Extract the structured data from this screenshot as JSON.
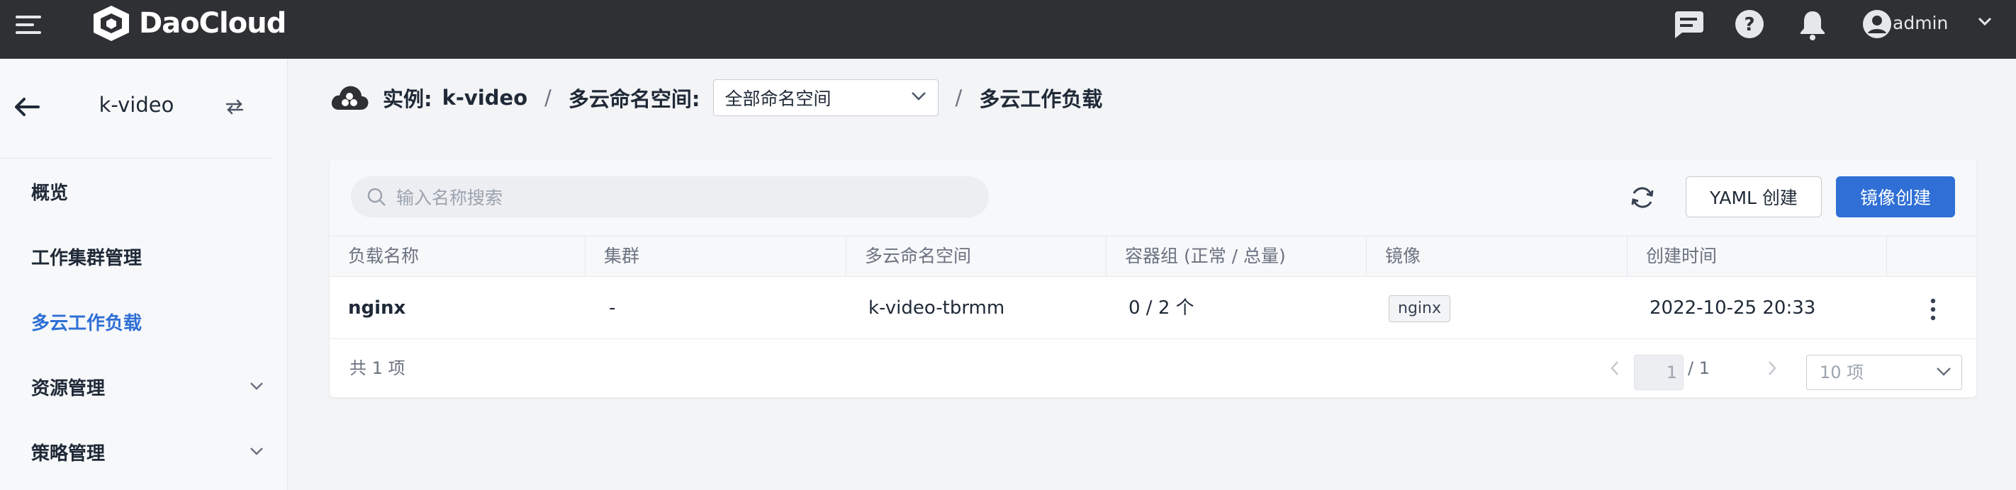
{
  "header": {
    "brand": "DaoCloud",
    "user": "admin",
    "icons": [
      "menu-icon",
      "logo-icon",
      "message-icon",
      "help-icon",
      "bell-icon",
      "user-icon",
      "chevron-down-icon"
    ]
  },
  "sidebar": {
    "title": "k-video",
    "items": [
      {
        "label": "概览",
        "active": false,
        "expandable": false
      },
      {
        "label": "工作集群管理",
        "active": false,
        "expandable": false
      },
      {
        "label": "多云工作负载",
        "active": true,
        "expandable": false
      },
      {
        "label": "资源管理",
        "active": false,
        "expandable": true
      },
      {
        "label": "策略管理",
        "active": false,
        "expandable": true
      }
    ]
  },
  "breadcrumb": {
    "instance_label": "实例:",
    "instance_value": "k-video",
    "namespace_label": "多云命名空间:",
    "namespace_select": "全部命名空间",
    "separator": "/",
    "current": "多云工作负载"
  },
  "toolbar": {
    "search_placeholder": "输入名称搜索",
    "yaml_button": "YAML 创建",
    "image_button": "镜像创建"
  },
  "table": {
    "columns": [
      "负载名称",
      "集群",
      "多云命名空间",
      "容器组 (正常 / 总量)",
      "镜像",
      "创建时间"
    ],
    "rows": [
      {
        "name": "nginx",
        "cluster": "-",
        "namespace": "k-video-tbrmm",
        "pods": "0 / 2 个",
        "image": "nginx",
        "created": "2022-10-25 20:33"
      }
    ]
  },
  "pagination": {
    "total": "共 1 项",
    "current_page": "1",
    "total_pages": "/ 1",
    "page_size": "10 项"
  },
  "colors": {
    "topbar": "#2f3033",
    "accent": "#2f6fd6",
    "active_nav": "#2f6fd6"
  }
}
